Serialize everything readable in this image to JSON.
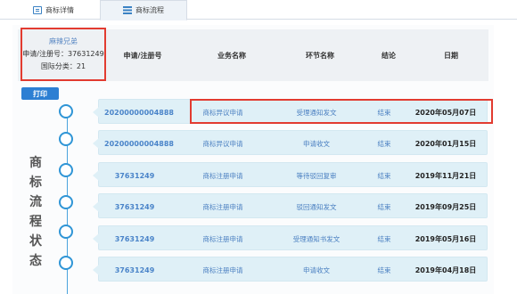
{
  "tabs": [
    {
      "label": "商标详情",
      "icon": "document-icon"
    },
    {
      "label": "商标流程",
      "icon": "list-icon"
    }
  ],
  "info": {
    "name": "麻辣兄弟",
    "registration": "申请/注册号：37631249",
    "class": "国际分类：21"
  },
  "headers": {
    "app_no": "申请/注册号",
    "business": "业务名称",
    "step": "环节名称",
    "result": "结论",
    "date": "日期"
  },
  "print_label": "打印",
  "side_label": [
    "商",
    "标",
    "流",
    "程",
    "状",
    "态"
  ],
  "rows": [
    {
      "app_no": "20200000004888",
      "business": "商标异议申请",
      "step": "受理通知发文",
      "result": "结束",
      "date": "2020年05月07日"
    },
    {
      "app_no": "20200000004888",
      "business": "商标异议申请",
      "step": "申请收文",
      "result": "结束",
      "date": "2020年01月15日"
    },
    {
      "app_no": "37631249",
      "business": "商标注册申请",
      "step": "等待驳回复审",
      "result": "结束",
      "date": "2019年11月21日"
    },
    {
      "app_no": "37631249",
      "business": "商标注册申请",
      "step": "驳回通知发文",
      "result": "结束",
      "date": "2019年09月25日"
    },
    {
      "app_no": "37631249",
      "business": "商标注册申请",
      "step": "受理通知书发文",
      "result": "结束",
      "date": "2019年05月16日"
    },
    {
      "app_no": "37631249",
      "business": "商标注册申请",
      "step": "申请收文",
      "result": "结束",
      "date": "2019年04月18日"
    }
  ],
  "colors": {
    "accent": "#2d7fd3",
    "highlight_border": "#e23b30",
    "row_bg": "#dff0f7"
  }
}
